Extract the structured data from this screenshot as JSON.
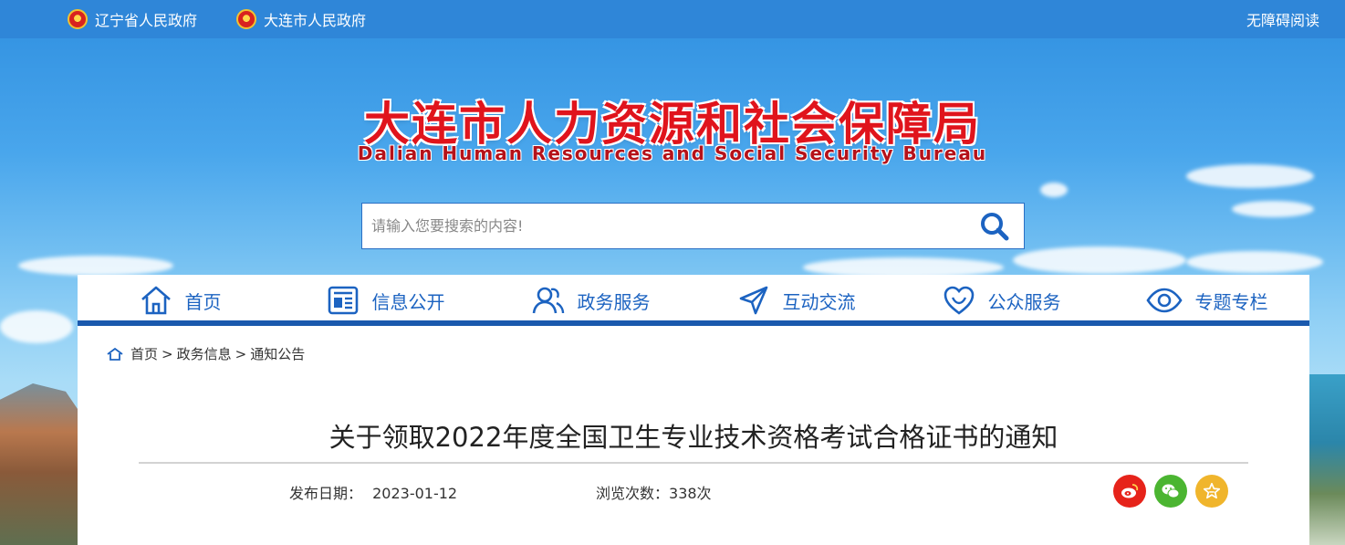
{
  "topbar": {
    "link1": "辽宁省人民政府",
    "link2": "大连市人民政府",
    "accessibility": "无障碍阅读"
  },
  "logo": {
    "cn": "大连市人力资源和社会保障局",
    "en": "Dalian Human Resources and Social Security Bureau"
  },
  "search": {
    "placeholder": "请输入您要搜索的内容!"
  },
  "nav": [
    {
      "label": "首页",
      "icon": "home-icon"
    },
    {
      "label": "信息公开",
      "icon": "news-icon"
    },
    {
      "label": "政务服务",
      "icon": "people-icon"
    },
    {
      "label": "互动交流",
      "icon": "send-icon"
    },
    {
      "label": "公众服务",
      "icon": "heart-icon"
    },
    {
      "label": "专题专栏",
      "icon": "eye-icon"
    }
  ],
  "breadcrumb": {
    "home": "首页",
    "level2": "政务信息",
    "level3": "通知公告",
    "sep": ">"
  },
  "article": {
    "title": "关于领取2022年度全国卫生专业技术资格考试合格证书的通知",
    "date_label": "发布日期：",
    "date": "2023-01-12",
    "views_label": "浏览次数：",
    "views": "338次"
  },
  "colors": {
    "brand_blue": "#1c63c1",
    "nav_border": "#1a59ad",
    "logo_red": "#e0141c",
    "weibo": "#e6231a",
    "wechat": "#4bb531",
    "favorite": "#f0b52c"
  }
}
